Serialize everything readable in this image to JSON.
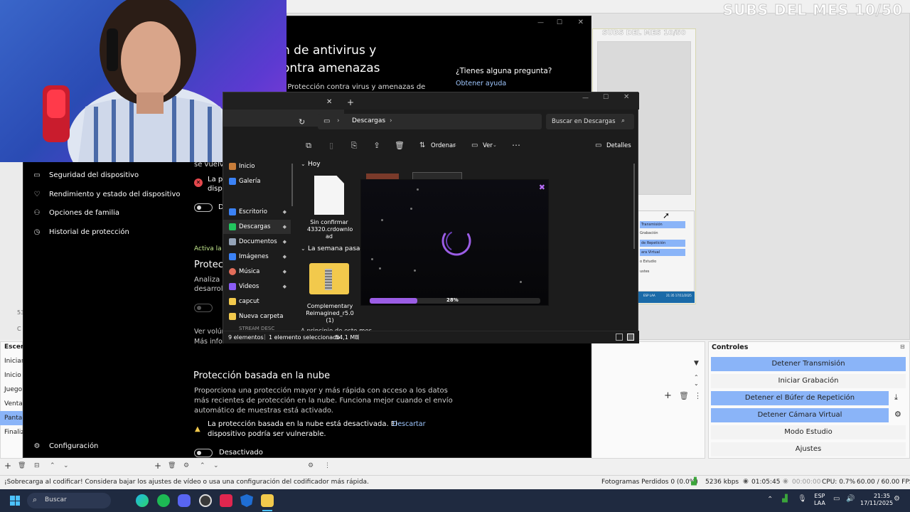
{
  "overlay": {
    "subs_title": "SUBS DEL MES 10/50"
  },
  "security": {
    "heading_line1": "n de antivirus y",
    "heading_line2": "ontra amenazas",
    "subtext": "ón de Protección contra virus y amenazas de",
    "help_title": "¿Tienes alguna pregunta?",
    "help_link": "Obtener ayuda",
    "nav_items": [
      {
        "label": "Seguridad del dispositivo",
        "icon": "laptop-icon"
      },
      {
        "label": "Rendimiento y estado del dispositivo",
        "icon": "heart-icon"
      },
      {
        "label": "Opciones de familia",
        "icon": "family-icon"
      },
      {
        "label": "Historial de protección",
        "icon": "history-icon"
      }
    ],
    "settings_label": "Configuración",
    "partial_se_vuelva": "se vuelva",
    "partial_la_p": "La p",
    "partial_disp": "disp",
    "partial_d": "D",
    "partial_activa": "Activa la p",
    "partial_protec": "Protec",
    "partial_analiza": "Analiza a",
    "partial_desarroll": "desarroll",
    "partial_ver_vol": "Ver volún",
    "mas_info": "Más información",
    "cloud_title": "Protección basada en la nube",
    "cloud_desc_1": "Proporciona una protección mayor y más rápida con acceso a los datos",
    "cloud_desc_2": "más recientes de protección en la nube. Funciona mejor cuando el envío",
    "cloud_desc_3": "automático de muestras está activado.",
    "warning_1": "La protección basada en la nube está desactivada. El",
    "warning_2": "dispositivo podría ser vulnerable.",
    "dismiss": "Descartar",
    "toggle_state": "Desactivado"
  },
  "explorer": {
    "breadcrumb": "Descargas",
    "search_placeholder": "Buscar en Descargas",
    "sort_label": "Ordenar",
    "view_label": "Ver",
    "details_label": "Detalles",
    "nav": [
      {
        "label": "Inicio",
        "color": "#c77d3a",
        "pinned": false
      },
      {
        "label": "Galería",
        "color": "#3b82f6",
        "pinned": false
      },
      {
        "label": "Escritorio",
        "color": "#3b82f6",
        "pinned": true
      },
      {
        "label": "Descargas",
        "color": "#22c55e",
        "pinned": true
      },
      {
        "label": "Documentos",
        "color": "#94a3b8",
        "pinned": true
      },
      {
        "label": "Imágenes",
        "color": "#3b82f6",
        "pinned": true
      },
      {
        "label": "Música",
        "color": "#e26d5a",
        "pinned": true
      },
      {
        "label": "Videos",
        "color": "#8b5cf6",
        "pinned": true
      },
      {
        "label": "capcut",
        "color": "#f2c94c",
        "pinned": false
      },
      {
        "label": "Nueva carpeta",
        "color": "#f2c94c",
        "pinned": false
      }
    ],
    "group_today": "Hoy",
    "group_last_week": "La semana pasad",
    "group_earlier": "A principio de este mes",
    "file1_name": "Sin confirmar 43320.crdownload",
    "file1_l1": "Sin confirmar",
    "file1_l2": "43320.crdownlo",
    "file1_l3": "ad",
    "file2_l1": "Complementary",
    "file2_l2": "Reimagined_r5.0",
    "file2_l3": "(1)",
    "status_items": "9 elementos",
    "status_selected": "1 elemento seleccionado",
    "status_size": "54,1 MB",
    "pin_glyph": "📌",
    "nav_partial": "STREAM DESC"
  },
  "loader": {
    "percent_text": "28%",
    "progress": 0.28
  },
  "obs": {
    "scenes_title": "Escena",
    "scenes": [
      "Inician",
      "Inicio",
      "Juego",
      "Venta",
      "Pantal",
      "Finaliz"
    ],
    "controls_title": "Controles",
    "controls": [
      {
        "label": "Detener Transmisión",
        "active": true
      },
      {
        "label": "Iniciar Grabación",
        "active": false
      },
      {
        "label": "Detener el Búfer de Repetición",
        "active": true
      },
      {
        "label": "Detener Cámara Virtual",
        "active": true
      },
      {
        "label": "Modo Estudio",
        "active": false
      },
      {
        "label": "Ajustes",
        "active": false
      }
    ],
    "mini_labels": [
      "Transmisión",
      "Grabación",
      "de Repetición",
      "ara Virtual",
      "o Estudio",
      "ustes"
    ],
    "status_warning": "¡Sobrecarga al codificar! Considera bajar los ajustes de vídeo o usa una configuración del codificador más rápida.",
    "dropped": "Fotogramas Perdidos 0 (0.0%)",
    "bitrate": "5236 kbps",
    "stream_time": "01:05:45",
    "rec_time": "00:00:00",
    "cpu": "CPU: 0.7%",
    "fps": "60.00 / 60.00 FPS",
    "side_frag": "53",
    "side_frag2": "C"
  },
  "taskbar": {
    "search": "Buscar",
    "lang1": "ESP",
    "lang2": "LAA",
    "time": "21:35",
    "date": "17/11/2025",
    "mini_lang": "ESP LAA",
    "mini_time": "21:35 17/11/2025"
  },
  "colors": {
    "accent": "#8ab4f8",
    "progress": "#9b5de5",
    "warning": "#f2c94c",
    "error": "#e5484d"
  }
}
